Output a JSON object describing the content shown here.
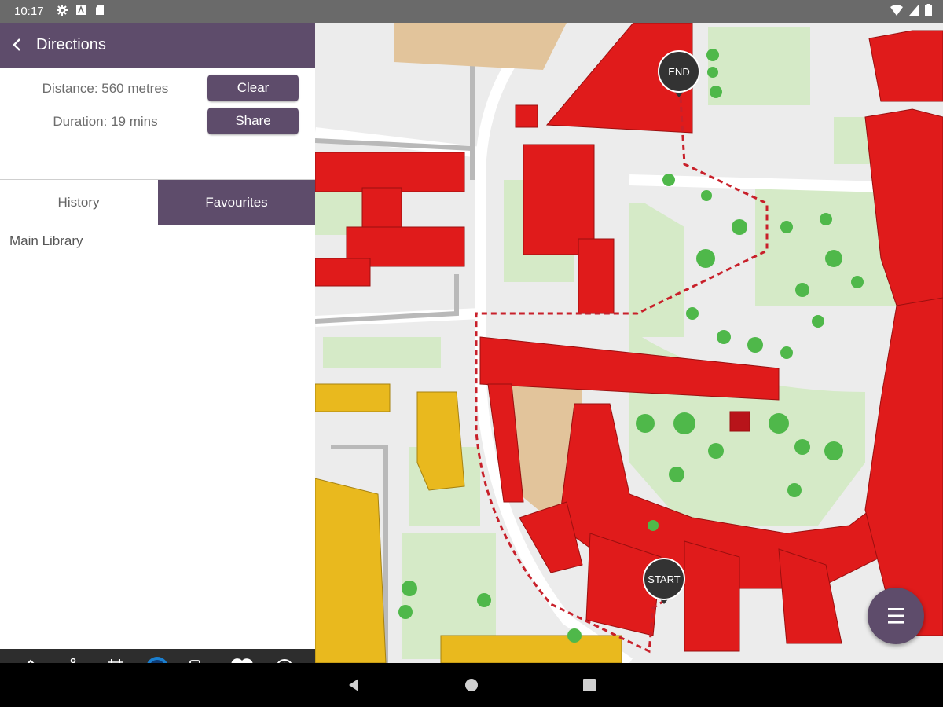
{
  "status_bar": {
    "time": "10:17",
    "left_icons": [
      "gear-icon",
      "store-icon",
      "sd-card-icon"
    ],
    "right_icons": [
      "wifi-icon",
      "signal-icon",
      "battery-icon"
    ]
  },
  "header": {
    "title": "Directions"
  },
  "route_info": {
    "distance": "Distance: 560 metres",
    "duration": "Duration: 19 mins",
    "clear_label": "Clear",
    "share_label": "Share"
  },
  "tabs": [
    {
      "label": "History",
      "selected": true
    },
    {
      "label": "Favourites",
      "selected": false
    }
  ],
  "history_items": [
    "Main Library"
  ],
  "bottom_nav": [
    "home-icon",
    "anchor-icon",
    "calendar-icon",
    "badge-icon",
    "bus-icon",
    "heart-icon",
    "info-icon"
  ],
  "map": {
    "markers": [
      {
        "label": "END"
      },
      {
        "label": "START"
      }
    ],
    "colors": {
      "building_red": "#e01b1b",
      "building_yellow": "#e9b91e",
      "green_space": "#d6ebc8",
      "tree_green": "#4fb84a",
      "path_dashed": "#c8202a",
      "sand": "#e2c49b"
    }
  },
  "fab": {
    "icon": "menu-icon"
  },
  "system_nav": [
    "back-icon",
    "home-circle-icon",
    "recents-icon"
  ],
  "colors": {
    "accent": "#5e4c6b",
    "status_bar": "#6a6a6a",
    "bottom_nav": "#2d2d2d"
  }
}
